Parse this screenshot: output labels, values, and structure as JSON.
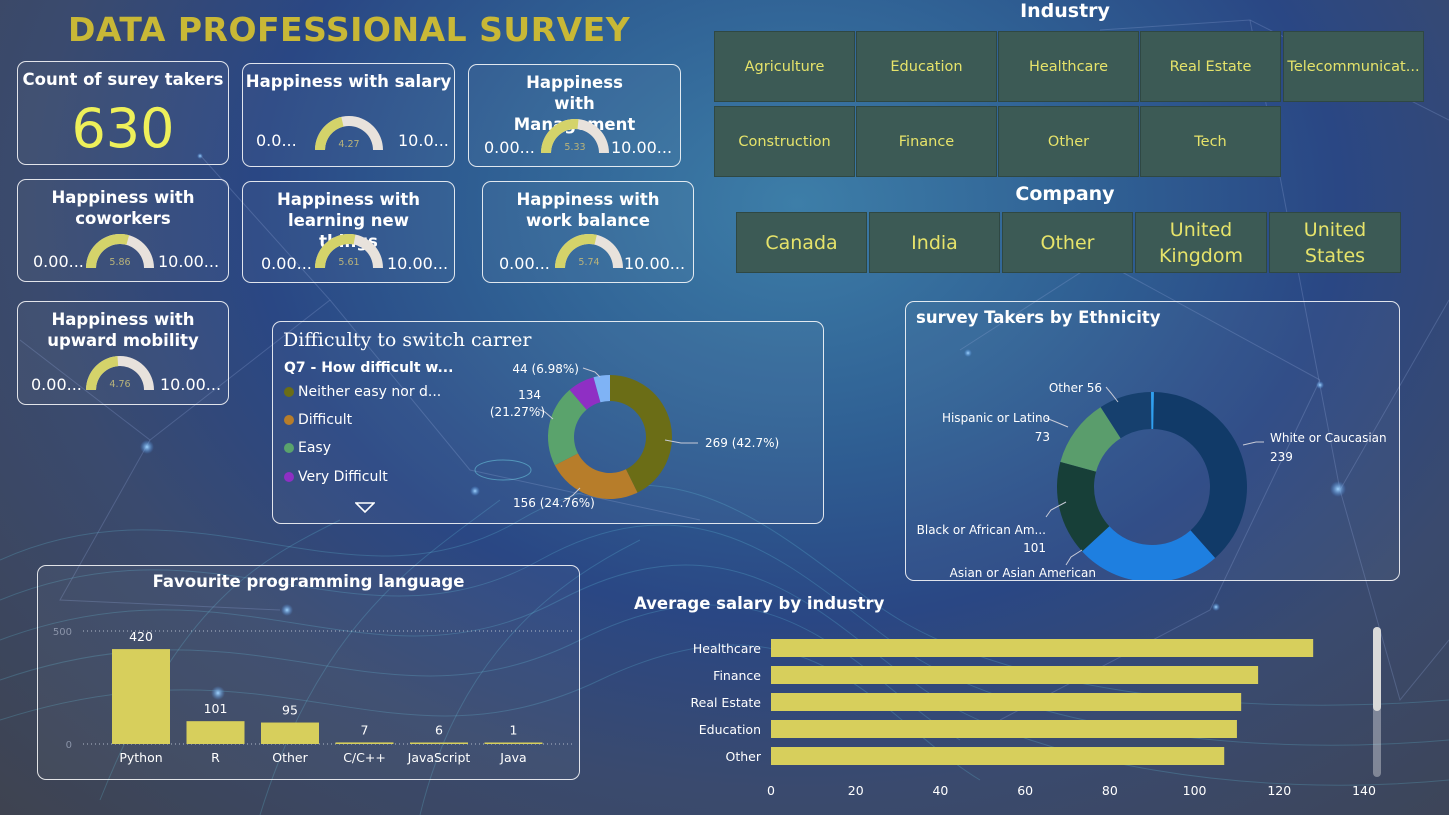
{
  "title": "DATA PROFESSIONAL SURVEY",
  "colors": {
    "accent": "#c9b836",
    "tile_bg": "#3c5a55",
    "tile_text": "#e6e36a",
    "bar": "#d7cf5c",
    "gauge_fill": "#d4d36a",
    "gauge_track": "#e8e2dc"
  },
  "kpi": {
    "label": "Count of surey takers",
    "value": "630"
  },
  "gauges": [
    {
      "id": "salary",
      "label": "Happiness with salary",
      "value": 4.27,
      "value_text": "4.27",
      "min_text": "0.0...",
      "max_text": "10.0...",
      "max": 10
    },
    {
      "id": "management",
      "label": "Happiness with Management",
      "value": 5.33,
      "value_text": "5.33",
      "min_text": "0.00...",
      "max_text": "10.00...",
      "max": 10
    },
    {
      "id": "coworkers",
      "label": "Happiness with coworkers",
      "value": 5.86,
      "value_text": "5.86",
      "min_text": "0.00...",
      "max_text": "10.00...",
      "max": 10
    },
    {
      "id": "learning",
      "label": "Happiness with learning new things",
      "value": 5.61,
      "value_text": "5.61",
      "min_text": "0.00...",
      "max_text": "10.00...",
      "max": 10
    },
    {
      "id": "balance",
      "label": "Happiness with work balance",
      "value": 5.74,
      "value_text": "5.74",
      "min_text": "0.00...",
      "max_text": "10.00...",
      "max": 10
    },
    {
      "id": "mobility",
      "label": "Happiness with upward mobility",
      "value": 4.76,
      "value_text": "4.76",
      "min_text": "0.00...",
      "max_text": "10.00...",
      "max": 10
    }
  ],
  "industry_slicer": {
    "title": "Industry",
    "items": [
      "Agriculture",
      "Education",
      "Healthcare",
      "Real Estate",
      "Telecommunicat...",
      "Construction",
      "Finance",
      "Other",
      "Tech"
    ]
  },
  "company_slicer": {
    "title": "Company",
    "items": [
      "Canada",
      "India",
      "Other",
      "United Kingdom",
      "United States"
    ]
  },
  "chart_data": [
    {
      "type": "pie",
      "title": "Difficulty to switch carrer",
      "legend_title": "Q7 - How difficult w...",
      "legend": [
        "Neither easy nor d...",
        "Difficult",
        "Easy",
        "Very Difficult"
      ],
      "slices": [
        {
          "name": "Neither easy nor d...",
          "value": 269,
          "label": "269 (42.7%)",
          "color": "#6b6d16"
        },
        {
          "name": "Difficult",
          "value": 156,
          "label": "156 (24.76%)",
          "color": "#b77d2a"
        },
        {
          "name": "Easy",
          "value": 134,
          "label": "134 (21.27%)",
          "color": "#5aa36c"
        },
        {
          "name": "Very Difficult",
          "value": 44,
          "label": "44 (6.98%)",
          "color": "#8f2fc4"
        },
        {
          "name": "",
          "value": 27,
          "label": "",
          "color": "#7fb3f5"
        }
      ]
    },
    {
      "type": "pie",
      "title": "survey Takers by Ethnicity",
      "slices": [
        {
          "name": "White or Caucasian",
          "value": 239,
          "label_name": "White or Caucasian",
          "label_value": "239",
          "color": "#113a68"
        },
        {
          "name": "Asian or Asian American",
          "value": 155,
          "label_name": "Asian or Asian American",
          "label_value": "155",
          "color": "#1e7fe0"
        },
        {
          "name": "Black or African Am...",
          "value": 101,
          "label_name": "Black or African Am...",
          "label_value": "101",
          "color": "#173f38"
        },
        {
          "name": "Hispanic or Latino",
          "value": 73,
          "label_name": "Hispanic or Latino",
          "label_value": "73",
          "color": "#5a9d6c"
        },
        {
          "name": "Other",
          "value": 56,
          "label_name": "Other 56",
          "label_value": "",
          "color": "#16406e"
        },
        {
          "name": "",
          "value": 3,
          "label_name": "",
          "label_value": "",
          "color": "#2fa0f0"
        }
      ]
    },
    {
      "type": "bar",
      "title": "Favourite programming language",
      "categories": [
        "Python",
        "R",
        "Other",
        "C/C++",
        "JavaScript",
        "Java"
      ],
      "values": [
        420,
        101,
        95,
        7,
        6,
        1
      ],
      "ylim": [
        0,
        500
      ],
      "yticks": [
        "500",
        "0"
      ],
      "grid": true
    },
    {
      "type": "bar",
      "orientation": "horizontal",
      "title": "Average salary by industry",
      "categories": [
        "Healthcare",
        "Finance",
        "Real Estate",
        "Education",
        "Other"
      ],
      "values": [
        128,
        115,
        111,
        110,
        107
      ],
      "xlim": [
        0,
        140
      ],
      "xticks": [
        "0",
        "20",
        "40",
        "60",
        "80",
        "100",
        "120",
        "140"
      ]
    }
  ]
}
